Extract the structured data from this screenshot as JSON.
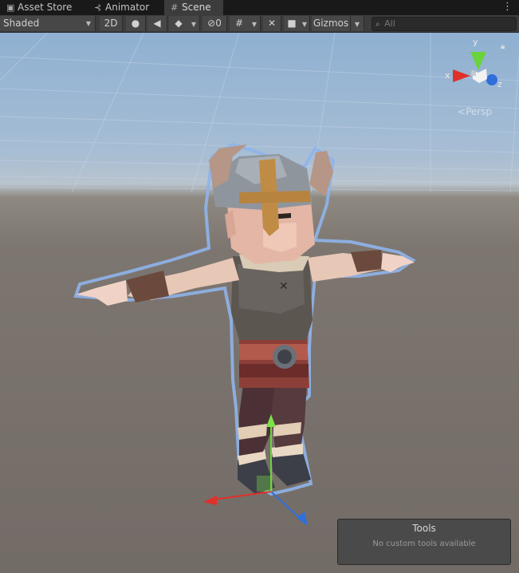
{
  "tabs": [
    {
      "label": "Asset Store",
      "icon": "shopping-bag-icon",
      "active": false
    },
    {
      "label": "Animator",
      "icon": "animator-icon",
      "active": false
    },
    {
      "label": "Scene",
      "icon": "scene-grid-icon",
      "active": true
    }
  ],
  "toolbar": {
    "draw_mode": "Shaded",
    "mode_2d": "2D",
    "hidden_count": "0",
    "gizmos": "Gizmos",
    "search_placeholder": "All"
  },
  "viewport": {
    "projection_label": "Persp",
    "axis_x": "x",
    "axis_y": "y",
    "axis_z": "z"
  },
  "tools_panel": {
    "title": "Tools",
    "message": "No custom tools available"
  },
  "colors": {
    "axis_x": "#e0302a",
    "axis_y": "#6ad33c",
    "axis_z": "#2f6fdc",
    "selection_outline": "#7fa8e8"
  }
}
